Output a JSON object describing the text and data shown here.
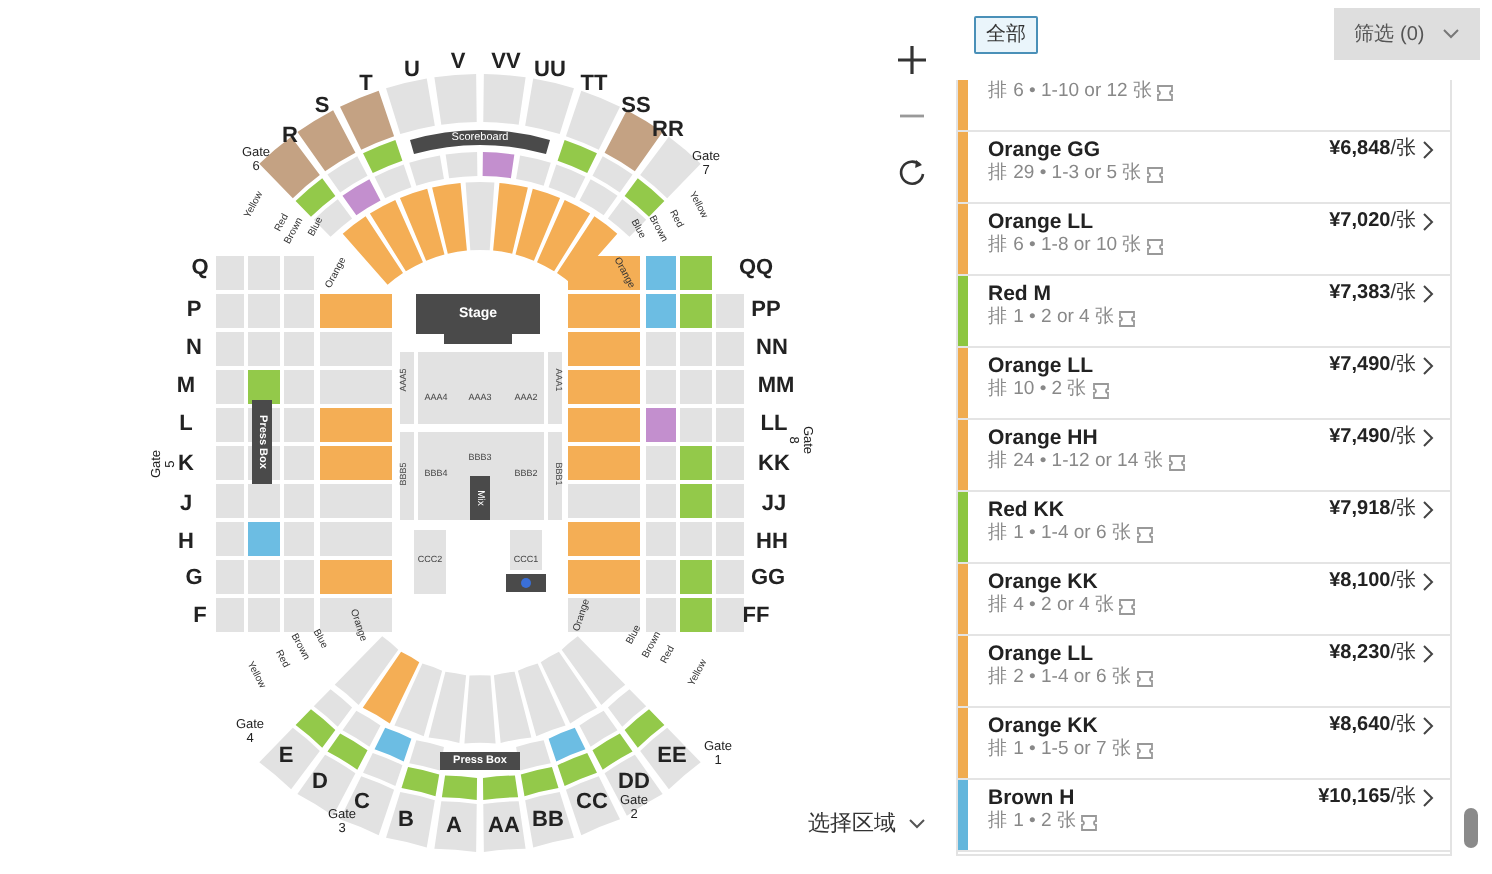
{
  "map": {
    "top_sections": [
      "R",
      "S",
      "T",
      "U",
      "V",
      "VV",
      "UU",
      "TT",
      "SS",
      "RR"
    ],
    "left_sections": [
      "Q",
      "P",
      "N",
      "M",
      "L",
      "K",
      "J",
      "H",
      "G",
      "F"
    ],
    "right_sections": [
      "QQ",
      "PP",
      "NN",
      "MM",
      "LL",
      "KK",
      "JJ",
      "HH",
      "GG",
      "FF"
    ],
    "bottom_sections": [
      "E",
      "D",
      "C",
      "B",
      "A",
      "AA",
      "BB",
      "CC",
      "DD",
      "EE"
    ],
    "gates": [
      {
        "label": "Gate",
        "number": "6"
      },
      {
        "label": "Gate",
        "number": "7"
      },
      {
        "label": "Gate",
        "number": "5"
      },
      {
        "label": "Gate",
        "number": "8"
      },
      {
        "label": "Gate",
        "number": "4"
      },
      {
        "label": "Gate",
        "number": "1"
      },
      {
        "label": "Gate",
        "number": "3"
      },
      {
        "label": "Gate",
        "number": "2"
      }
    ],
    "stage": "Stage",
    "scoreboard": "Scoreboard",
    "press_boxes": [
      "Press Box",
      "Press Box"
    ],
    "floor_sections": [
      "AAA5",
      "AAA4",
      "AAA3",
      "AAA2",
      "AAA1",
      "BBB5",
      "BBB4",
      "BBB3",
      "BBB2",
      "BBB1",
      "CCC2",
      "CCC1"
    ],
    "mix": "Mix",
    "aisle_labels": [
      "Yellow",
      "Red",
      "Brown",
      "Blue",
      "Orange",
      "Blue",
      "Brown",
      "Red",
      "Yellow",
      "Orange",
      "Yellow",
      "Red",
      "Brown",
      "Blue",
      "Orange",
      "Blue",
      "Brown",
      "Red",
      "Yellow",
      "Orange"
    ]
  },
  "select_area": "选择区域",
  "filters": {
    "all": "全部",
    "filter": "筛选 (0)"
  },
  "listings": [
    {
      "detail": "排 6 • 1-10 or 12 张",
      "color": "#f0ab4f"
    },
    {
      "title": "Orange GG",
      "detail": "排 29 • 1-3 or 5 张",
      "price": "**¥6,848**/张",
      "color": "#f0ab4f"
    },
    {
      "title": "Orange LL",
      "detail": "排 6 • 1-8 or 10 张",
      "price": "**¥7,020**/张",
      "color": "#f0ab4f"
    },
    {
      "title": "Red M",
      "detail": "排 1 • 2 or 4 张",
      "price": "**¥7,383**/张",
      "color": "#8cc640"
    },
    {
      "title": "Orange LL",
      "detail": "排 10 • 2 张",
      "price": "**¥7,490**/张",
      "color": "#f0ab4f"
    },
    {
      "title": "Orange HH",
      "detail": "排 24 • 1-12 or 14 张",
      "price": "**¥7,490**/张",
      "color": "#f0ab4f"
    },
    {
      "title": "Red KK",
      "detail": "排 1 • 1-4 or 6 张",
      "price": "**¥7,918**/张",
      "color": "#8cc640"
    },
    {
      "title": "Orange KK",
      "detail": "排 4 • 2 or 4 张",
      "price": "**¥8,100**/张",
      "color": "#f0ab4f"
    },
    {
      "title": "Orange LL",
      "detail": "排 2 • 1-4 or 6 张",
      "price": "**¥8,230**/张",
      "color": "#f0ab4f"
    },
    {
      "title": "Orange KK",
      "detail": "排 1 • 1-5 or 7 张",
      "price": "**¥8,640**/张",
      "color": "#f0ab4f"
    },
    {
      "title": "Brown H",
      "detail": "排 1 • 2 张",
      "price": "**¥10,165**/张",
      "color": "#63b6dc"
    }
  ]
}
